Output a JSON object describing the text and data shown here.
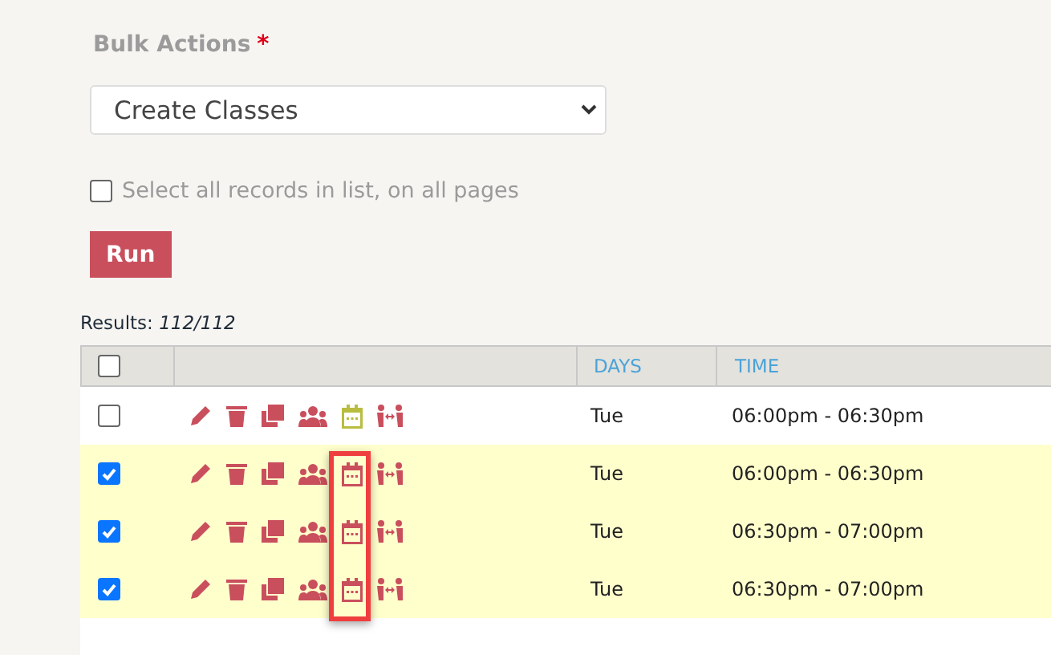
{
  "bulk_actions": {
    "label": "Bulk Actions",
    "required_mark": "*",
    "value": "Create Classes"
  },
  "select_all": {
    "label": "Select all records in list, on all pages",
    "checked": false
  },
  "run_button": "Run",
  "results": {
    "label": "Results:",
    "count": "112/112"
  },
  "table": {
    "header_checked": false,
    "columns": [
      "DAYS",
      "TIME"
    ],
    "rows": [
      {
        "selected": false,
        "highlighted": false,
        "calendar": {
          "color": "#b9bd3f"
        },
        "days": "Tue",
        "time": "06:00pm - 06:30pm"
      },
      {
        "selected": true,
        "highlighted": true,
        "calendar": {
          "color": "#c94f5d"
        },
        "days": "Tue",
        "time": "06:00pm - 06:30pm"
      },
      {
        "selected": true,
        "highlighted": true,
        "calendar": {
          "color": "#c94f5d"
        },
        "days": "Tue",
        "time": "06:30pm - 07:00pm"
      },
      {
        "selected": true,
        "highlighted": true,
        "calendar": {
          "color": "#c94f5d"
        },
        "days": "Tue",
        "time": "06:30pm - 07:00pm"
      }
    ]
  }
}
